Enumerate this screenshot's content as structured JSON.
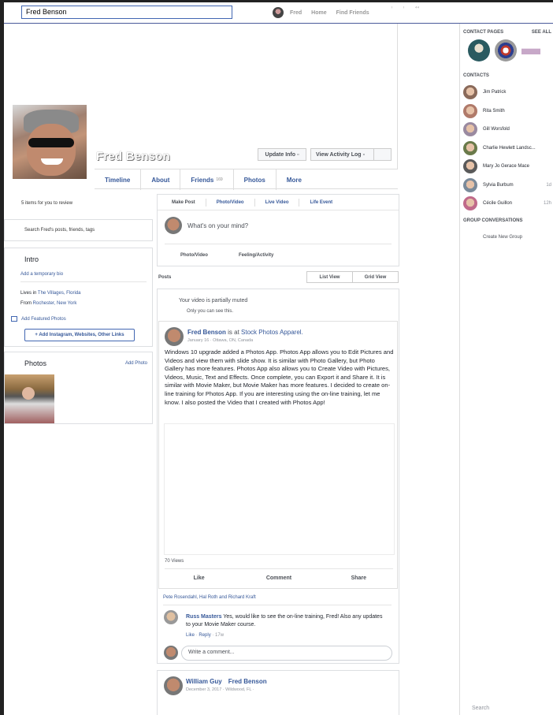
{
  "topbar": {
    "search_value": "Fred Benson",
    "user_name": "Fred",
    "home": "Home",
    "find_friends": "Find Friends"
  },
  "profile": {
    "name": "Fred Benson",
    "update_info": "Update Info",
    "view_activity_log": "View Activity Log"
  },
  "tabs": [
    {
      "label": "Timeline"
    },
    {
      "label": "About"
    },
    {
      "label": "Friends",
      "count": "169"
    },
    {
      "label": "Photos"
    },
    {
      "label": "More"
    }
  ],
  "left": {
    "review": "5 items for you to review",
    "search_fred": "Search Fred's posts, friends, tags",
    "intro": {
      "title": "Intro",
      "add_bio": "Add a temporary bio",
      "lives_in_prefix": "Lives in ",
      "lives_in": "The Villages, Florida",
      "from_prefix": "From ",
      "from": "Rochester, New York",
      "add_featured": "Add Featured Photos",
      "add_links": "+ Add Instagram, Websites, Other Links"
    },
    "photos": {
      "title": "Photos",
      "add": "Add Photo"
    }
  },
  "composer": {
    "tabs": [
      "Make Post",
      "Photo/Video",
      "Live Video",
      "Life Event"
    ],
    "placeholder": "What's on your mind?",
    "photo_video": "Photo/Video",
    "feeling": "Feeling/Activity"
  },
  "feed": {
    "posts_label": "Posts",
    "list_view": "List View",
    "grid_view": "Grid View",
    "muted_title": "Your video is partially muted",
    "muted_sub": "Only you can see this.",
    "post": {
      "author": "Fred Benson",
      "is_at": "is at",
      "page": "Stock Photos Apparel.",
      "meta": "January 16 · Ottawa, ON, Canada",
      "text": "Windows 10 upgrade added a Photos App. Photos App allows you to Edit Pictures and Videos and view them with slide show. It is similar with Photo Gallery, but Photo Gallery has more features. Photos App also allows you to Create Video with Pictures, Videos, Music, Text and Effects. Once complete, you can Export it and Share it. It is similar with Movie Maker, but Movie Maker has more features. I decided to create on-line training for Photos App. If you are interesting using the on-line training, let me know. I also posted the Video that I created with Photos App!",
      "views": "70 Views",
      "like": "Like",
      "comment": "Comment",
      "share": "Share",
      "likers": "Pete Rosendahl, Hal Roth and Richard Kraft",
      "comment_author": "Russ Masters",
      "comment_text": "Yes, would like to see the on-line training, Fred! Also any updates to your Movie Maker course.",
      "comment_like": "Like",
      "comment_reply": "Reply",
      "comment_time": "17w",
      "write_comment": "Write a comment..."
    },
    "post2": {
      "author1": "William Guy",
      "author2": "Fred Benson",
      "meta": "December 3, 2017 · Wildwood, FL ·"
    }
  },
  "right": {
    "contact_pages": "CONTACT PAGES",
    "see_all": "SEE ALL",
    "contacts_title": "CONTACTS",
    "contacts": [
      {
        "name": "Jim Patrick",
        "time": "",
        "color": "#8a6a5a"
      },
      {
        "name": "Rita Smith",
        "time": "",
        "color": "#b07a6a"
      },
      {
        "name": "Gill Worsfold",
        "time": "",
        "color": "#9a8aa0"
      },
      {
        "name": "Charlie Hewlett Landsc...",
        "time": "",
        "color": "#6a7a4a"
      },
      {
        "name": "Mary Jo Gerace Mace",
        "time": "",
        "color": "#5a5a5a"
      },
      {
        "name": "Sylvia Burbum",
        "time": "1d",
        "color": "#7a8a9a"
      },
      {
        "name": "Cécile Guillon",
        "time": "12h",
        "color": "#c06a8a"
      }
    ],
    "group_conversations": "GROUP CONVERSATIONS",
    "create_group": "Create New Group",
    "search": "Search"
  }
}
